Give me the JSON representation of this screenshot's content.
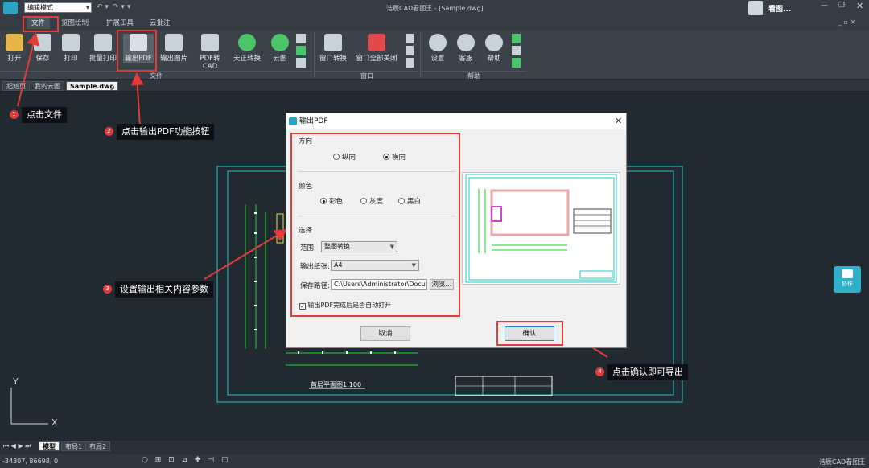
{
  "titlebar": {
    "mode": "编辑模式",
    "title": "浩辰CAD看图王 - [Sample.dwg]",
    "user": "看图..."
  },
  "menu": {
    "tabs": [
      "文件",
      "览图绘制",
      "扩展工具",
      "云批注"
    ]
  },
  "ribbon": {
    "file_buttons": [
      "打开",
      "保存",
      "打印",
      "批量打印",
      "输出PDF",
      "输出图片",
      "PDF转CAD",
      "天正转换",
      "云图"
    ],
    "window_buttons": [
      "窗口转换",
      "窗口全部关闭"
    ],
    "help_buttons": [
      "设置",
      "客服",
      "帮助"
    ],
    "groups": [
      "文件",
      "窗口",
      "帮助"
    ]
  },
  "doc_tabs": [
    "起始页",
    "我的云图",
    "Sample.dwg"
  ],
  "callouts": [
    {
      "num": "1",
      "text": "点击文件"
    },
    {
      "num": "2",
      "text": "点击输出PDF功能按钮"
    },
    {
      "num": "3",
      "text": "设置输出相关内容参数"
    },
    {
      "num": "4",
      "text": "点击确认即可导出"
    }
  ],
  "dialog": {
    "title": "输出PDF",
    "direction_label": "方向",
    "orientation": [
      "纵向",
      "横向"
    ],
    "orientation_selected": "横向",
    "color_label": "颜色",
    "colors": [
      "彩色",
      "灰度",
      "黑白"
    ],
    "color_selected": "彩色",
    "select_label": "选择",
    "range_label": "范围:",
    "range_value": "整图转换",
    "paper_label": "输出纸张:",
    "paper_value": "A4",
    "path_label": "保存路径:",
    "path_value": "C:\\Users\\Administrator\\Documents\\",
    "browse": "浏览...",
    "auto_open": "输出PDF完成后是否自动打开",
    "cancel": "取消",
    "confirm": "确认"
  },
  "drawing": {
    "caption": "首层平面图1:100"
  },
  "side_widget": {
    "label": "协作"
  },
  "layout_tabs": [
    "模型",
    "布局1",
    "布局2"
  ],
  "status": {
    "coords": "-34307, 86698, 0",
    "app": "浩辰CAD看图王"
  },
  "colors": {
    "accent": "#e33a3a",
    "cad_green": "#19d62a",
    "cad_cyan": "#20c8c8",
    "widget": "#2fb0c8"
  }
}
